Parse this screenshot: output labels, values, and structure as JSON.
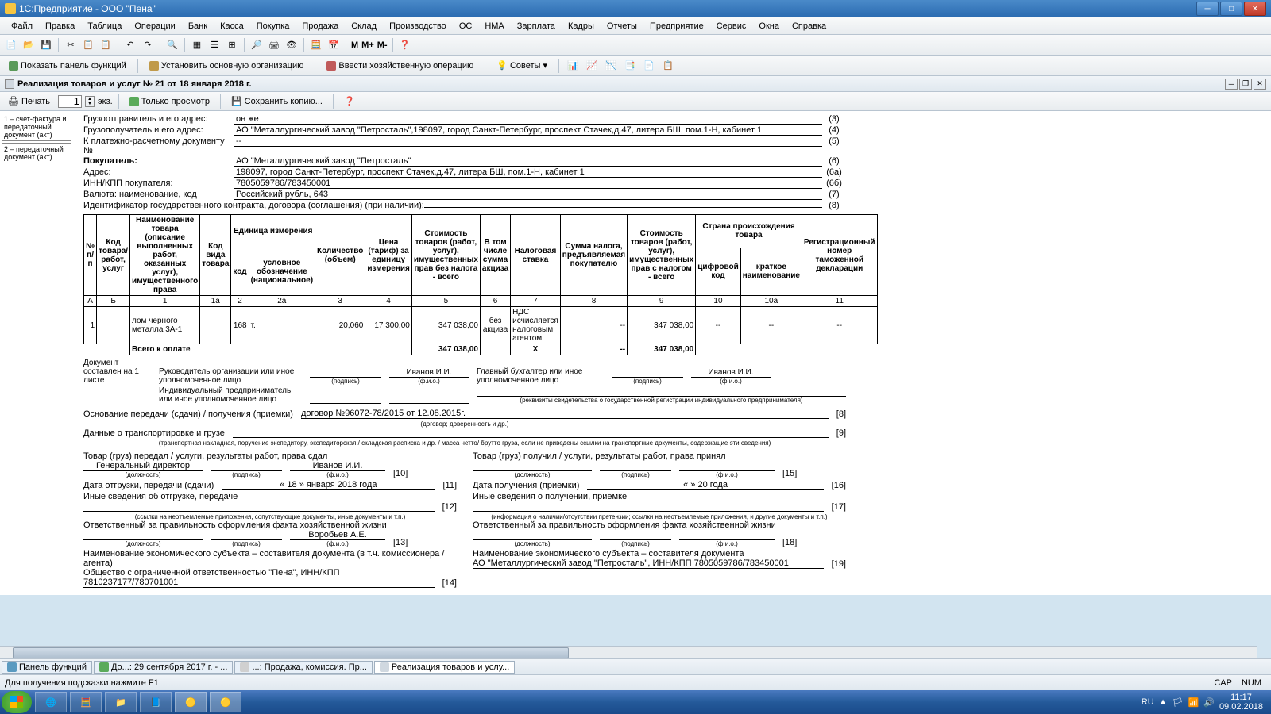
{
  "window": {
    "title": "1С:Предприятие - ООО \"Пена\""
  },
  "menu": [
    "Файл",
    "Правка",
    "Таблица",
    "Операции",
    "Банк",
    "Касса",
    "Покупка",
    "Продажа",
    "Склад",
    "Производство",
    "ОС",
    "НМА",
    "Зарплата",
    "Кадры",
    "Отчеты",
    "Предприятие",
    "Сервис",
    "Окна",
    "Справка"
  ],
  "tb1_mem": [
    "M",
    "M+",
    "M-"
  ],
  "tb2": {
    "panel": "Показать панель функций",
    "org": "Установить основную организацию",
    "oper": "Ввести хозяйственную операцию",
    "tips": "Советы"
  },
  "doc": {
    "title": "Реализация товаров и услуг № 21 от 18 января 2018 г."
  },
  "doctool": {
    "print": "Печать",
    "copies": "1",
    "ex": "экз.",
    "view": "Только просмотр",
    "save": "Сохранить копию..."
  },
  "left": {
    "a": "1 – счет-фактура и передаточный документ (акт)",
    "b": "2 – передаточный документ (акт)"
  },
  "header": {
    "r1l": "Грузоотправитель и его адрес:",
    "r1v": "он же",
    "r1c": "(3)",
    "r2l": "Грузополучатель и его адрес:",
    "r2v": "АО \"Металлургический завод \"Петросталь\",198097, город Санкт-Петербург, проспект Стачек,д.47, литера БШ, пом.1-Н, кабинет 1",
    "r2c": "(4)",
    "r3l": "К платежно-расчетному документу №",
    "r3v": "--",
    "r3c": "(5)",
    "r4l": "Покупатель:",
    "r4v": "АО \"Металлургический завод \"Петросталь\"",
    "r4c": "(6)",
    "r5l": "Адрес:",
    "r5v": "198097, город Санкт-Петербург, проспект Стачек,д.47, литера БШ, пом.1-Н, кабинет 1",
    "r5c": "(6а)",
    "r6l": "ИНН/КПП покупателя:",
    "r6v": "7805059786/783450001",
    "r6c": "(6б)",
    "r7l": "Валюта: наименование, код",
    "r7v": "Российский рубль, 643",
    "r7c": "(7)",
    "r8l": "Идентификатор государственного контракта, договора (соглашения) (при наличии):",
    "r8v": "",
    "r8c": "(8)"
  },
  "cols": {
    "c1": "№ п/п",
    "c2": "Код товара/ работ, услуг",
    "c3": "Наименование товара (описание выполненных работ, оказанных услуг), имущественного права",
    "c4": "Код вида товара",
    "c5": "Единица измерения",
    "c5a": "код",
    "c5b": "условное обозначение (национальное)",
    "c6": "Количество (объем)",
    "c7": "Цена (тариф) за единицу измерения",
    "c8": "Стоимость товаров (работ, услуг), имущественных прав без налога - всего",
    "c9": "В том числе сумма акциза",
    "c10": "Налоговая ставка",
    "c11": "Сумма налога, предъявляемая покупателю",
    "c12": "Стоимость товаров (работ, услуг), имущественных прав с налогом - всего",
    "c13": "Страна происхождения товара",
    "c13a": "цифровой код",
    "c13b": "краткое наименование",
    "c14": "Регистрационный номер таможенной декларации"
  },
  "idx": {
    "a": "А",
    "b": "Б",
    "c1": "1",
    "c1a": "1а",
    "c2": "2",
    "c2a": "2а",
    "c3": "3",
    "c4": "4",
    "c5": "5",
    "c6": "6",
    "c7": "7",
    "c8": "8",
    "c9": "9",
    "c10": "10",
    "c10a": "10а",
    "c11": "11"
  },
  "row": {
    "n": "1",
    "name": "лом черного металла 3А-1",
    "kod": "168",
    "ed": "т.",
    "qty": "20,060",
    "price": "17 300,00",
    "sum": "347 038,00",
    "akz": "без акциза",
    "stavka": "НДС исчисляется налоговым агентом",
    "nalog": "--",
    "total": "347 038,00",
    "ck": "--",
    "cn": "--",
    "reg": "--"
  },
  "total": {
    "lbl": "Всего к оплате",
    "sum": "347 038,00",
    "x": "Х",
    "nalog": "--",
    "tot": "347 038,00"
  },
  "sig": {
    "doc": "Документ составлен на 1 листе",
    "ruk": "Руководитель организации или иное уполномоченное лицо",
    "ruk_name": "Иванов И.И.",
    "buh": "Главный бухгалтер или иное уполномоченное лицо",
    "buh_name": "Иванов И.И.",
    "ip": "Индивидуальный предприниматель или иное уполномоченное лицо",
    "podp": "(подпись)",
    "fio": "(ф.и.о.)",
    "rekv": "(реквизиты свидетельства о государственной регистрации индивидуального предпринимателя)"
  },
  "osn": {
    "lbl": "Основание передачи (сдачи) / получения (приемки)",
    "val": "договор №96072-78/2015 от 12.08.2015г.",
    "hint": "(договор; доверенность и др.)",
    "c": "[8]"
  },
  "trans": {
    "lbl": "Данные о транспортировке и грузе",
    "hint": "(транспортная накладная, поручение экспедитору, экспедиторская / складская расписка и др. / масса нетто/ брутто груза, если не приведены ссылки на транспортные документы, содержащие эти сведения)",
    "c": "[9]"
  },
  "left_block": {
    "t1": "Товар (груз) передал / услуги, результаты работ, права сдал",
    "dir": "Генеральный директор",
    "dir_name": "Иванов И.И.",
    "c10": "[10]",
    "dolz": "(должность)",
    "date": "Дата отгрузки, передачи (сдачи)",
    "dv": "« 18 »   января   2018  года",
    "c11": "[11]",
    "other": "Иные сведения об отгрузке, передаче",
    "c12": "[12]",
    "oh": "(ссылки на неотъемлемые приложения, сопутствующие документы, иные документы и т.п.)",
    "resp": "Ответственный за правильность оформления факта хозяйственной жизни",
    "resp_name": "Воробьев А.Е.",
    "c13": "[13]",
    "subj": "Наименование экономического субъекта – составителя документа (в т.ч. комиссионера / агента)",
    "subj_v": "Общество с ограниченной ответственностью \"Пена\", ИНН/КПП 7810237177/780701001",
    "c14": "[14]"
  },
  "right_block": {
    "t1": "Товар (груз) получил / услуги, результаты работ, права принял",
    "c15": "[15]",
    "date": "Дата получения (приемки)",
    "dv": "«    »                20     года",
    "c16": "[16]",
    "other": "Иные сведения о получении, приемке",
    "c17": "[17]",
    "oh": "(информация о наличии/отсутствии претензии; ссылки на неотъемлемые приложения, и другие  документы и т.п.)",
    "resp": "Ответственный за правильность оформления факта хозяйственной жизни",
    "c18": "[18]",
    "subj": "Наименование экономического субъекта – составителя документа",
    "subj_v": "АО \"Металлургический завод \"Петросталь\", ИНН/КПП 7805059786/783450001",
    "c19": "[19]"
  },
  "tasks": {
    "a": "Панель функций",
    "b": "До...: 29 сентября 2017 г. - ...",
    "c": "...: Продажа, комиссия. Пр...",
    "d": "Реализация товаров и услу..."
  },
  "status": {
    "hint": "Для получения подсказки нажмите F1",
    "cap": "CAP",
    "num": "NUM"
  },
  "tray": {
    "lang": "RU",
    "time": "11:17",
    "date": "09.02.2018"
  }
}
